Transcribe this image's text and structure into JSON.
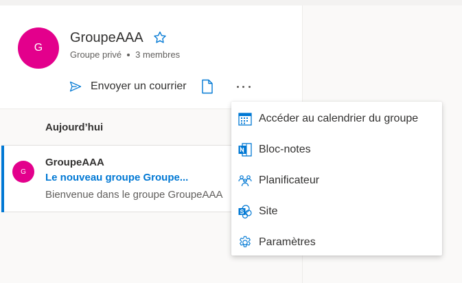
{
  "group": {
    "avatar_initial": "G",
    "name": "GroupeAAA",
    "privacy": "Groupe privé",
    "members": "3 membres",
    "avatar_color": "#e3008c"
  },
  "actions": {
    "send_mail_label": "Envoyer un courrier",
    "icons": [
      "send-icon",
      "document-icon",
      "more-icon"
    ]
  },
  "feed": {
    "section_title": "Aujourd’hui",
    "messages": [
      {
        "avatar_initial": "G",
        "sender": "GroupeAAA",
        "subject": "Le nouveau groupe Groupe...",
        "preview": "Bienvenue dans le groupe GroupeAAA"
      }
    ]
  },
  "menu": {
    "items": [
      {
        "label": "Accéder au calendrier du groupe",
        "icon": "calendar-icon"
      },
      {
        "label": "Bloc-notes",
        "icon": "onenote-icon"
      },
      {
        "label": "Planificateur",
        "icon": "planner-icon"
      },
      {
        "label": "Site",
        "icon": "sharepoint-icon"
      },
      {
        "label": "Paramètres",
        "icon": "gear-icon"
      }
    ]
  },
  "colors": {
    "accent": "#0078d4",
    "avatar": "#e3008c",
    "text": "#323130",
    "secondary_text": "#605e5c"
  }
}
